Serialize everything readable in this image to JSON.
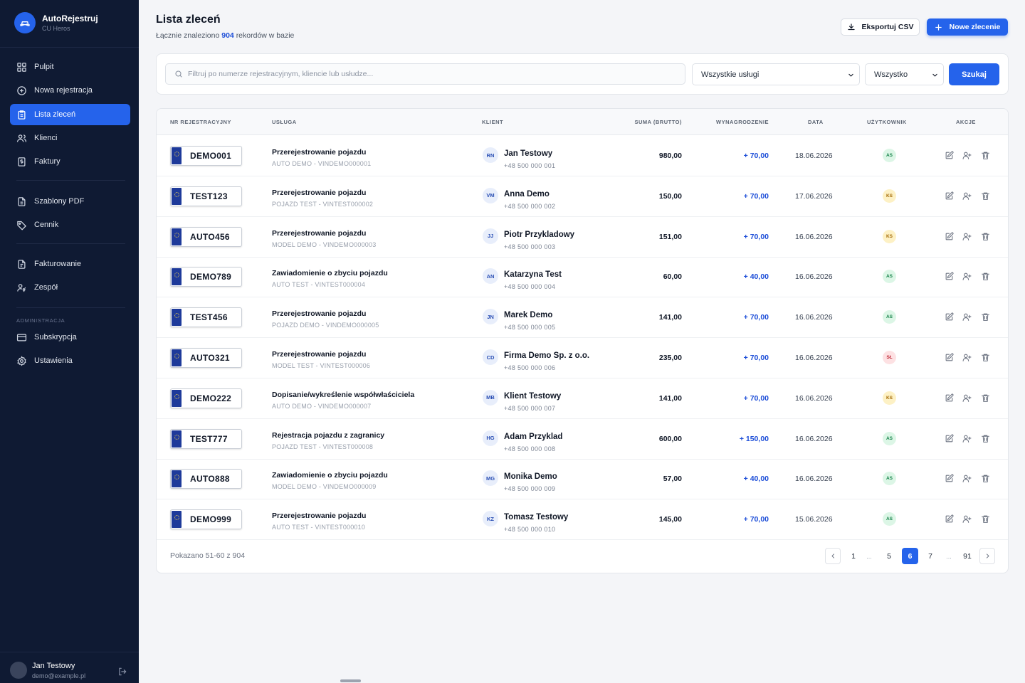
{
  "brand": {
    "name": "AutoRejestruj",
    "subtitle": "CU Heros"
  },
  "nav": {
    "items": [
      {
        "label": "Pulpit",
        "icon": "grid-icon"
      },
      {
        "label": "Nowa rejestracja",
        "icon": "plus-circle-icon"
      },
      {
        "label": "Lista zleceń",
        "icon": "clipboard-list-icon",
        "active": true
      },
      {
        "label": "Klienci",
        "icon": "users-icon"
      },
      {
        "label": "Faktury",
        "icon": "receipt-icon"
      },
      {
        "label": "Szablony PDF",
        "icon": "file-icon"
      },
      {
        "label": "Cennik",
        "icon": "tag-icon"
      },
      {
        "label": "Fakturowanie",
        "icon": "file-text-icon"
      },
      {
        "label": "Zespół",
        "icon": "user-key-icon"
      }
    ],
    "admin_section": "ADMINISTRACJA",
    "admin_items": [
      {
        "label": "Subskrypcja",
        "icon": "credit-card-icon"
      },
      {
        "label": "Ustawienia",
        "icon": "gear-icon"
      }
    ]
  },
  "user": {
    "name": "Jan Testowy",
    "email": "demo@example.pl"
  },
  "header": {
    "title": "Lista zleceń",
    "subtitle_prefix": "Łącznie znaleziono",
    "subtitle_count": "904",
    "subtitle_suffix": "rekordów w bazie",
    "export_label": "Eksportuj CSV",
    "new_label": "Nowe zlecenie"
  },
  "filters": {
    "search_placeholder": "Filtruj po numerze rejestracyjnym, kliencie lub usłudze...",
    "search_value": "",
    "service_select": "Wszystkie usługi",
    "status_select": "Wszystko",
    "search_button": "Szukaj"
  },
  "table": {
    "columns": [
      "NR REJESTRACYJNY",
      "USŁUGA",
      "KLIENT",
      "SUMA (BRUTTO)",
      "WYNAGRODZENIE",
      "DATA",
      "UŻYTKOWNIK",
      "AKCJE"
    ],
    "rows": [
      {
        "plate": "DEMO001",
        "service": "Przerejestrowanie pojazdu",
        "vehicle": "AUTO DEMO - VINDEMO000001",
        "initials": "RN",
        "client": "Jan Testowy",
        "phone": "+48 500 000 001",
        "sum": "980,00",
        "fee": "+ 70,00",
        "date": "18.06.2026",
        "user": "AS",
        "user_color": "green"
      },
      {
        "plate": "TEST123",
        "service": "Przerejestrowanie pojazdu",
        "vehicle": "POJAZD TEST - VINTEST000002",
        "initials": "VM",
        "client": "Anna Demo",
        "phone": "+48 500 000 002",
        "sum": "150,00",
        "fee": "+ 70,00",
        "date": "17.06.2026",
        "user": "KS",
        "user_color": "yellow"
      },
      {
        "plate": "AUTO456",
        "service": "Przerejestrowanie pojazdu",
        "vehicle": "MODEL DEMO - VINDEMO000003",
        "initials": "JJ",
        "client": "Piotr Przykladowy",
        "phone": "+48 500 000 003",
        "sum": "151,00",
        "fee": "+ 70,00",
        "date": "16.06.2026",
        "user": "KS",
        "user_color": "yellow"
      },
      {
        "plate": "DEMO789",
        "service": "Zawiadomienie o zbyciu pojazdu",
        "vehicle": "AUTO TEST - VINTEST000004",
        "initials": "AN",
        "client": "Katarzyna Test",
        "phone": "+48 500 000 004",
        "sum": "60,00",
        "fee": "+ 40,00",
        "date": "16.06.2026",
        "user": "AS",
        "user_color": "green"
      },
      {
        "plate": "TEST456",
        "service": "Przerejestrowanie pojazdu",
        "vehicle": "POJAZD DEMO - VINDEMO000005",
        "initials": "JN",
        "client": "Marek Demo",
        "phone": "+48 500 000 005",
        "sum": "141,00",
        "fee": "+ 70,00",
        "date": "16.06.2026",
        "user": "AS",
        "user_color": "green"
      },
      {
        "plate": "AUTO321",
        "service": "Przerejestrowanie pojazdu",
        "vehicle": "MODEL TEST - VINTEST000006",
        "initials": "CD",
        "client": "Firma Demo Sp. z o.o.",
        "phone": "+48 500 000 006",
        "sum": "235,00",
        "fee": "+ 70,00",
        "date": "16.06.2026",
        "user": "SŁ",
        "user_color": "red"
      },
      {
        "plate": "DEMO222",
        "service": "Dopisanie/wykreślenie współwłaściciela",
        "vehicle": "AUTO DEMO - VINDEMO000007",
        "initials": "MB",
        "client": "Klient Testowy",
        "phone": "+48 500 000 007",
        "sum": "141,00",
        "fee": "+ 70,00",
        "date": "16.06.2026",
        "user": "KS",
        "user_color": "yellow"
      },
      {
        "plate": "TEST777",
        "service": "Rejestracja pojazdu z zagranicy",
        "vehicle": "POJAZD TEST - VINTEST000008",
        "initials": "HG",
        "client": "Adam Przyklad",
        "phone": "+48 500 000 008",
        "sum": "600,00",
        "fee": "+ 150,00",
        "date": "16.06.2026",
        "user": "AS",
        "user_color": "green"
      },
      {
        "plate": "AUTO888",
        "service": "Zawiadomienie o zbyciu pojazdu",
        "vehicle": "MODEL DEMO - VINDEMO000009",
        "initials": "MG",
        "client": "Monika Demo",
        "phone": "+48 500 000 009",
        "sum": "57,00",
        "fee": "+ 40,00",
        "date": "16.06.2026",
        "user": "AS",
        "user_color": "green"
      },
      {
        "plate": "DEMO999",
        "service": "Przerejestrowanie pojazdu",
        "vehicle": "AUTO TEST - VINTEST000010",
        "initials": "KZ",
        "client": "Tomasz Testowy",
        "phone": "+48 500 000 010",
        "sum": "145,00",
        "fee": "+ 70,00",
        "date": "15.06.2026",
        "user": "AS",
        "user_color": "green"
      }
    ]
  },
  "pagination": {
    "summary": "Pokazano 51-60 z 904",
    "pages": [
      "1",
      "...",
      "5",
      "6",
      "7",
      "...",
      "91"
    ],
    "current": "6"
  },
  "colors": {
    "sidebar": "#0f1a33",
    "accent": "#2563eb",
    "fee_text": "#1d4ed8"
  }
}
